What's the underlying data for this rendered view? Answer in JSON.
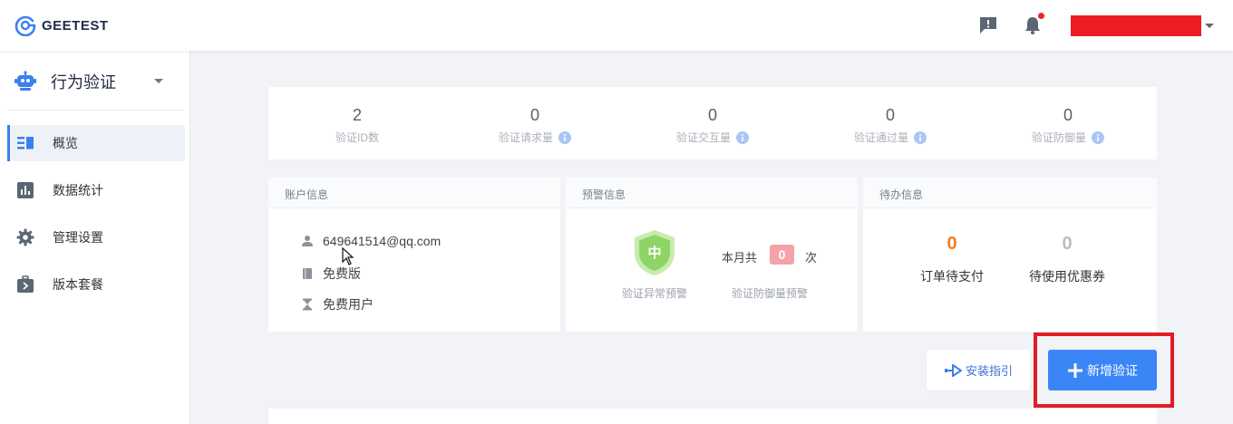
{
  "header": {
    "brand": "GEETEST",
    "colors": {
      "brand_blue": "#3b80f0",
      "user_redacted": "#ee1d23",
      "notification_dot": "#e8262d"
    }
  },
  "sidebar": {
    "product": {
      "name": "行为验证",
      "icon": "robot-icon"
    },
    "items": [
      {
        "label": "概览",
        "icon": "overview-icon",
        "active": true
      },
      {
        "label": "数据统计",
        "icon": "bar-chart-icon",
        "active": false
      },
      {
        "label": "管理设置",
        "icon": "gear-icon",
        "active": false
      },
      {
        "label": "版本套餐",
        "icon": "package-icon",
        "active": false
      }
    ]
  },
  "stats": [
    {
      "value": "2",
      "label": "验证ID数",
      "has_info": false
    },
    {
      "value": "0",
      "label": "验证请求量",
      "has_info": true
    },
    {
      "value": "0",
      "label": "验证交互量",
      "has_info": true
    },
    {
      "value": "0",
      "label": "验证通过量",
      "has_info": true
    },
    {
      "value": "0",
      "label": "验证防御量",
      "has_info": true
    }
  ],
  "account": {
    "title": "账户信息",
    "email": "649641514@qq.com",
    "plan": "免费版",
    "user_type": "免费用户"
  },
  "warning": {
    "title": "预警信息",
    "level": "中",
    "level_caption": "验证异常预警",
    "month_label": "本月共",
    "count": "0",
    "unit": "次",
    "count_caption": "验证防御量预警"
  },
  "todo": {
    "title": "待办信息",
    "orders": {
      "value": "0",
      "label": "订单待支付",
      "color": "#ef7d22"
    },
    "coupons": {
      "value": "0",
      "label": "待使用优惠券",
      "color": "#b7bdc6"
    }
  },
  "actions": {
    "guide_label": "安装指引",
    "add_label": "新增验证"
  }
}
